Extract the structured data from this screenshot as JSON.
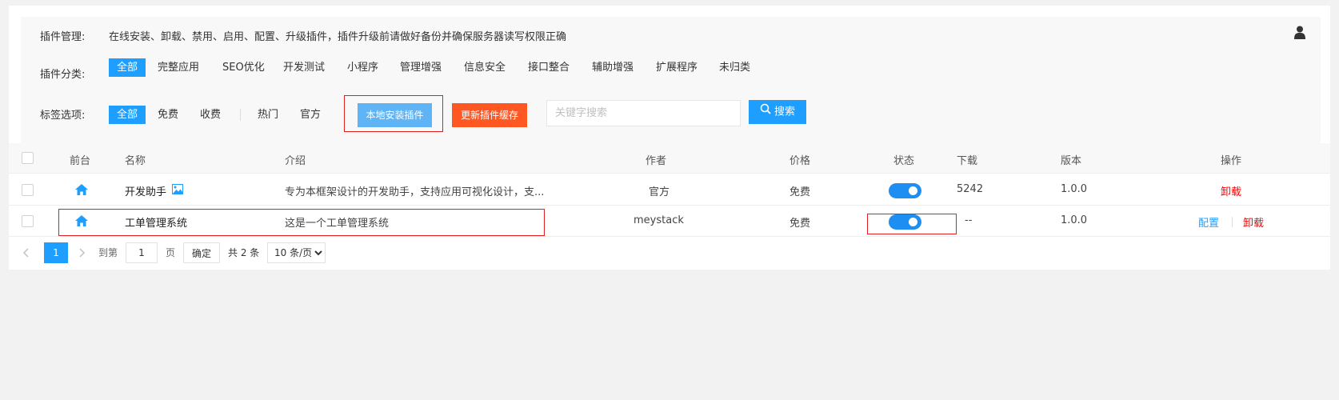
{
  "header": {
    "plugin_mgmt_label": "插件管理:",
    "plugin_mgmt_desc": "在线安装、卸载、禁用、启用、配置、升级插件，插件升级前请做好备份并确保服务器读写权限正确",
    "user_icon": "user-icon"
  },
  "category": {
    "label": "插件分类:",
    "items": [
      "全部",
      "完整应用",
      "SEO优化",
      "开发测试",
      "小程序",
      "管理增强",
      "信息安全",
      "接口整合",
      "辅助增强",
      "扩展程序",
      "未归类"
    ],
    "active_index": 0
  },
  "tags": {
    "label": "标签选项:",
    "items": [
      "全部",
      "免费",
      "收费",
      "热门",
      "官方"
    ],
    "active_index": 0
  },
  "toolbar": {
    "local_install_label": "本地安装插件",
    "refresh_cache_label": "更新插件缓存",
    "search_placeholder": "关键字搜索",
    "search_label": "搜索"
  },
  "table": {
    "columns": [
      "前台",
      "名称",
      "介绍",
      "作者",
      "价格",
      "状态",
      "下载",
      "版本",
      "操作"
    ],
    "rows": [
      {
        "name": "开发助手",
        "intro": "专为本框架设计的开发助手，支持应用可视化设计，支...",
        "author": "官方",
        "price": "免费",
        "enabled": true,
        "downloads": "5242",
        "version": "1.0.0",
        "actions": [
          "卸载"
        ]
      },
      {
        "name": "工单管理系统",
        "intro": "这是一个工单管理系统",
        "author": "meystack",
        "price": "免费",
        "enabled": true,
        "downloads": "--",
        "version": "1.0.0",
        "actions": [
          "配置",
          "卸载"
        ]
      }
    ]
  },
  "pagination": {
    "current_page": "1",
    "goto_label": "到第",
    "goto_value": "1",
    "page_unit": "页",
    "confirm_label": "确定",
    "total_label": "共 2 条",
    "page_size_option": "10 条/页"
  },
  "colors": {
    "primary": "#1e9fff",
    "orange": "#ff5722",
    "danger": "#ff0000",
    "highlight_box": "#e02020"
  }
}
